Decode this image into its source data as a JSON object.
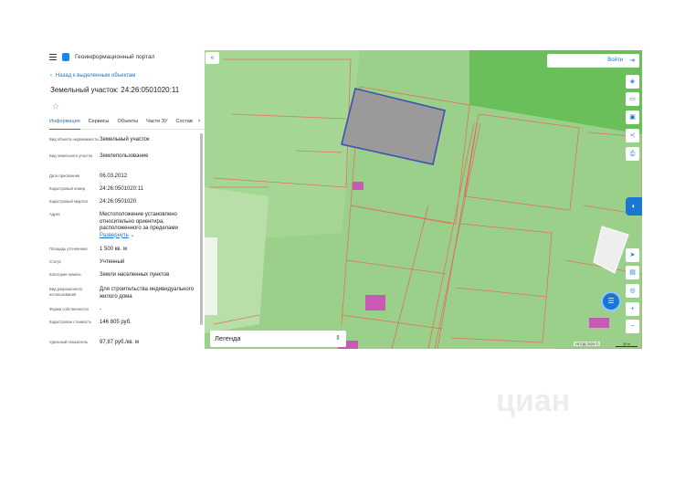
{
  "app": {
    "portal_name": "Геоинформационный портал",
    "back_link": "Назад к выделенным объектам",
    "object_title": "Земельный участок: 24:26:0501020:11"
  },
  "tabs": [
    "Информация",
    "Сервисы",
    "Объекты",
    "Части ЗУ",
    "Состав"
  ],
  "properties": [
    {
      "label": "Вид объекта недвижимости",
      "value": "Земельный участок"
    },
    {
      "label": "Вид земельного участка",
      "value": "Землепользование"
    },
    {
      "label": "Дата присвоения",
      "value": "06.03.2012"
    },
    {
      "label": "Кадастровый номер",
      "value": "24:26:0501020:11"
    },
    {
      "label": "Кадастровый квартал",
      "value": "24:26:0501020"
    },
    {
      "label": "Адрес",
      "value": "Местоположение установлено относительно ориентира, расположенного за пределами",
      "link": "Развернуть"
    },
    {
      "label": "Площадь уточненная",
      "value": "1 500 кв. м"
    },
    {
      "label": "Статус",
      "value": "Учтенный"
    },
    {
      "label": "Категория земель",
      "value": "Земли населенных пунктов"
    },
    {
      "label": "Вид разрешенного использования",
      "value": "Для строительства индивидуального жилого дома"
    },
    {
      "label": "Форма собственности",
      "value": "-"
    },
    {
      "label": "Кадастровая стоимость",
      "value": "146 805 руб."
    },
    {
      "label": "Удельный показатель",
      "value": "97,87 руб./кв. м"
    }
  ],
  "map": {
    "login_label": "Войти",
    "legend_label": "Легенда",
    "attribution": "НСПД 2024 ©",
    "scale": "30 м",
    "colors": {
      "grass": "#9bd08a",
      "dark_green": "#6bbf5a",
      "parcel_border": "#e0745a",
      "selected_fill": "#9a9a9a",
      "selected_border": "#3f51b5",
      "building": "#c85ab4",
      "accent": "#1976d2"
    }
  },
  "icons": [
    "menu-icon",
    "portal-logo-icon",
    "back-arrow-icon",
    "star-icon",
    "collapse-icon",
    "login-icon",
    "layers-icon",
    "ruler-icon",
    "print-icon",
    "share-icon",
    "locate-icon",
    "chat-icon",
    "zoom-in-icon",
    "zoom-out-icon"
  ],
  "watermark": "циан"
}
